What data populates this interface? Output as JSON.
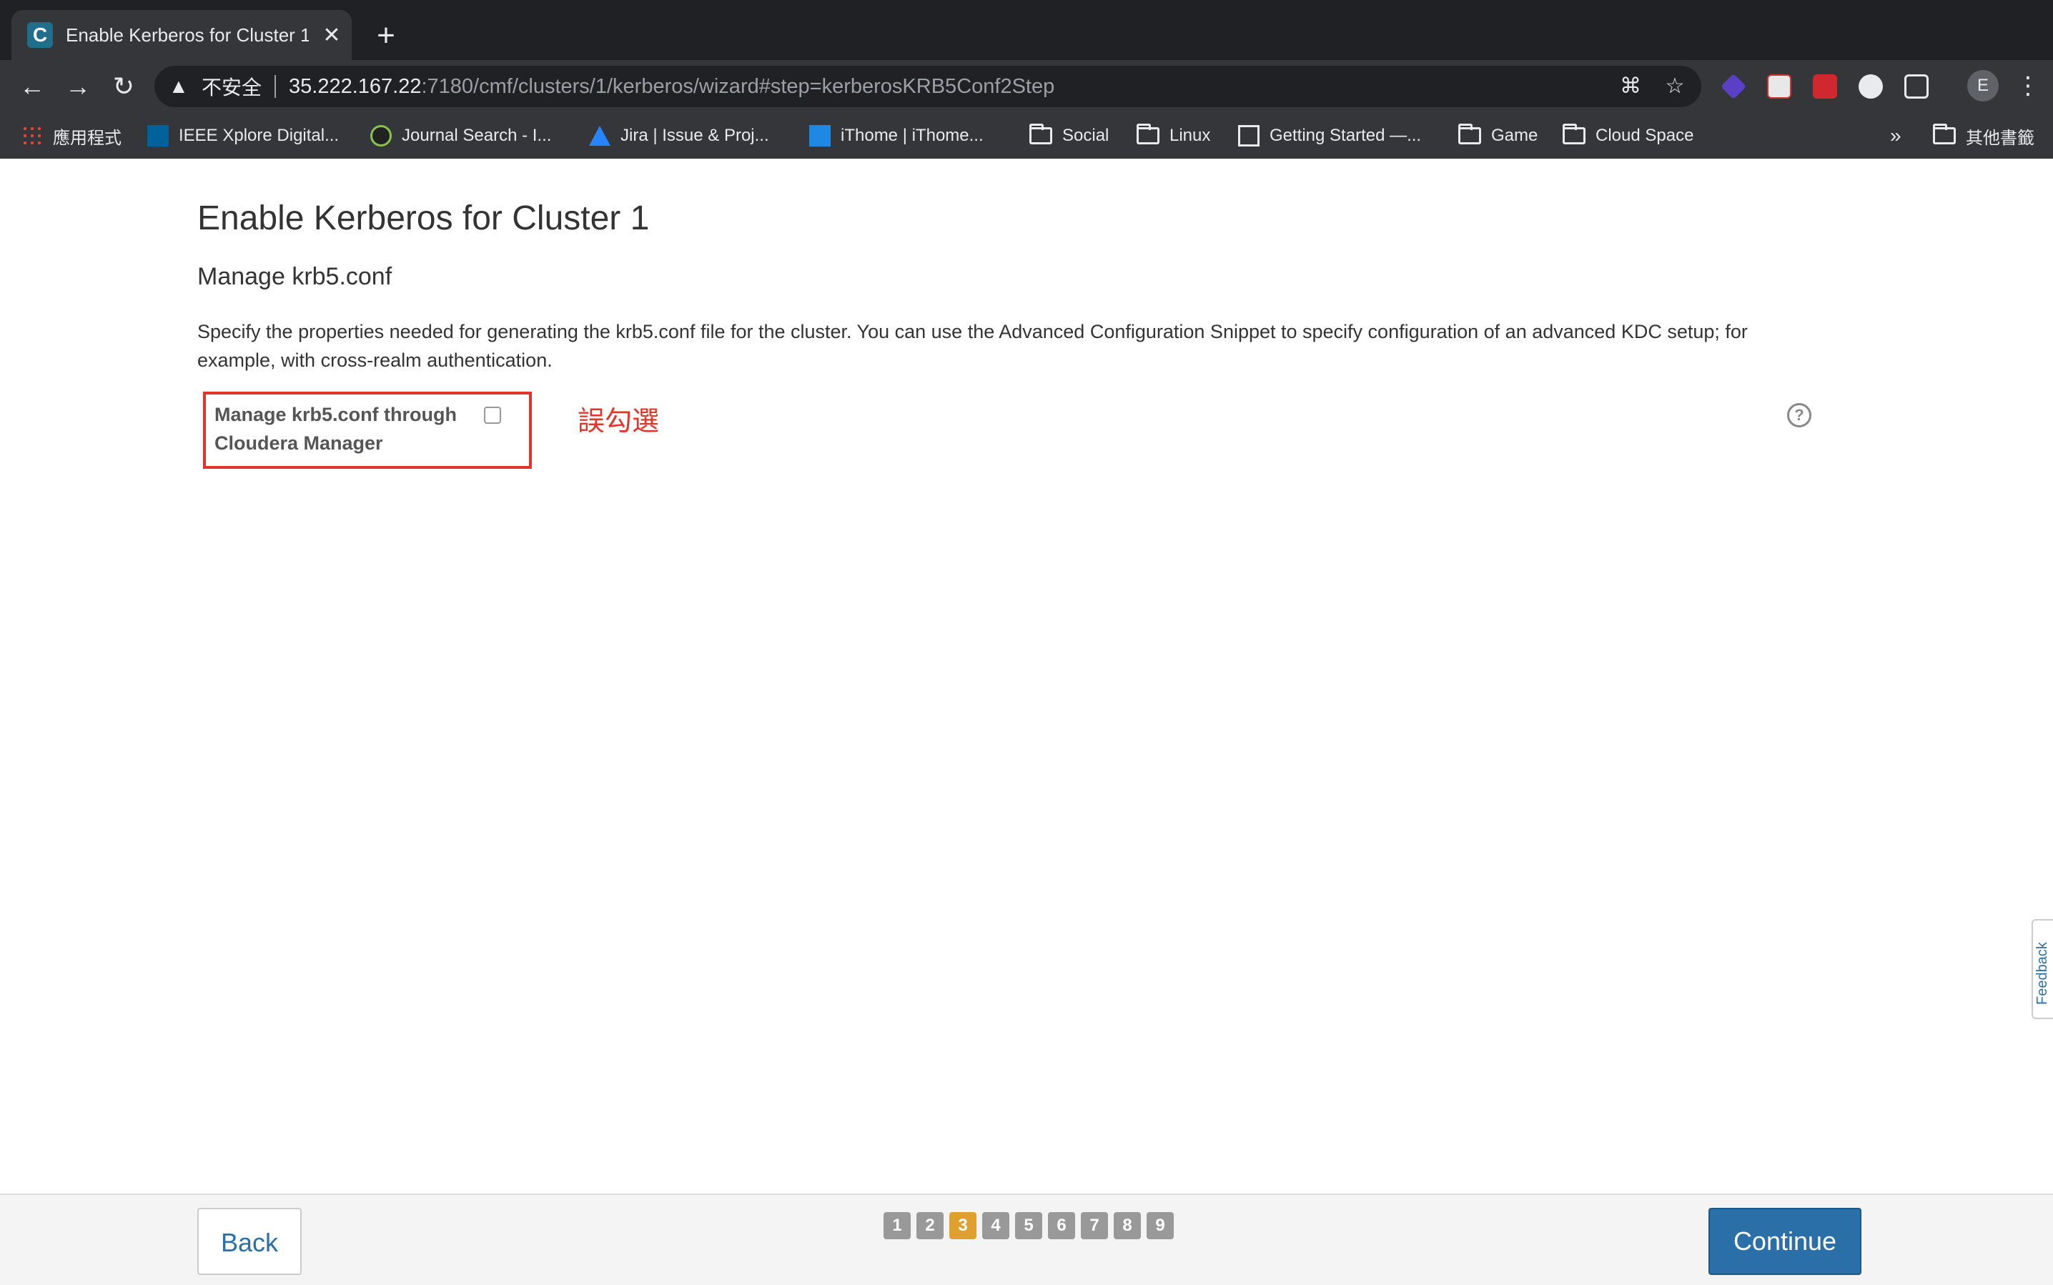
{
  "browser": {
    "tab_title": "Enable Kerberos for Cluster 1 -",
    "tab_favicon_letter": "C",
    "new_tab_label": "+",
    "close_label": "✕",
    "omnibox": {
      "security_label": "不安全",
      "host": "35.222.167.22",
      "path": ":7180/cmf/clusters/1/kerberos/wizard#step=kerberosKRB5Conf2Step"
    },
    "profile_letter": "E",
    "bookmarks": [
      {
        "label": "應用程式",
        "icon": "apps-grid-icon"
      },
      {
        "label": "IEEE Xplore Digital...",
        "icon": "ieee-icon"
      },
      {
        "label": "Journal Search - I...",
        "icon": "journal-icon"
      },
      {
        "label": "Jira | Issue & Proj...",
        "icon": "jira-icon"
      },
      {
        "label": "iThome | iThome...",
        "icon": "ithome-icon"
      },
      {
        "label": "Social",
        "icon": "folder-icon"
      },
      {
        "label": "Linux",
        "icon": "folder-icon"
      },
      {
        "label": "Getting Started —...",
        "icon": "getting-started-icon"
      },
      {
        "label": "Game",
        "icon": "folder-icon"
      },
      {
        "label": "Cloud Space",
        "icon": "folder-icon"
      }
    ],
    "more_bookmarks": "»",
    "other_bookmarks": "其他書籤"
  },
  "page": {
    "title": "Enable Kerberos for Cluster 1",
    "subtitle": "Manage krb5.conf",
    "description": "Specify the properties needed for generating the krb5.conf file for the cluster. You can use the Advanced Configuration Snippet to specify configuration of an advanced KDC setup; for example, with cross-realm authentication.",
    "property": {
      "label": "Manage krb5.conf through Cloudera Manager",
      "checked": false
    },
    "annotation": "誤勾選",
    "help_glyph": "?",
    "feedback_label": "Feedback"
  },
  "footer": {
    "back_label": "Back",
    "continue_label": "Continue",
    "steps": [
      "1",
      "2",
      "3",
      "4",
      "5",
      "6",
      "7",
      "8",
      "9"
    ],
    "current_step": 3
  },
  "colors": {
    "accent": "#2b6fa8",
    "active_step": "#e0a030",
    "annotation_red": "#e0352b"
  }
}
